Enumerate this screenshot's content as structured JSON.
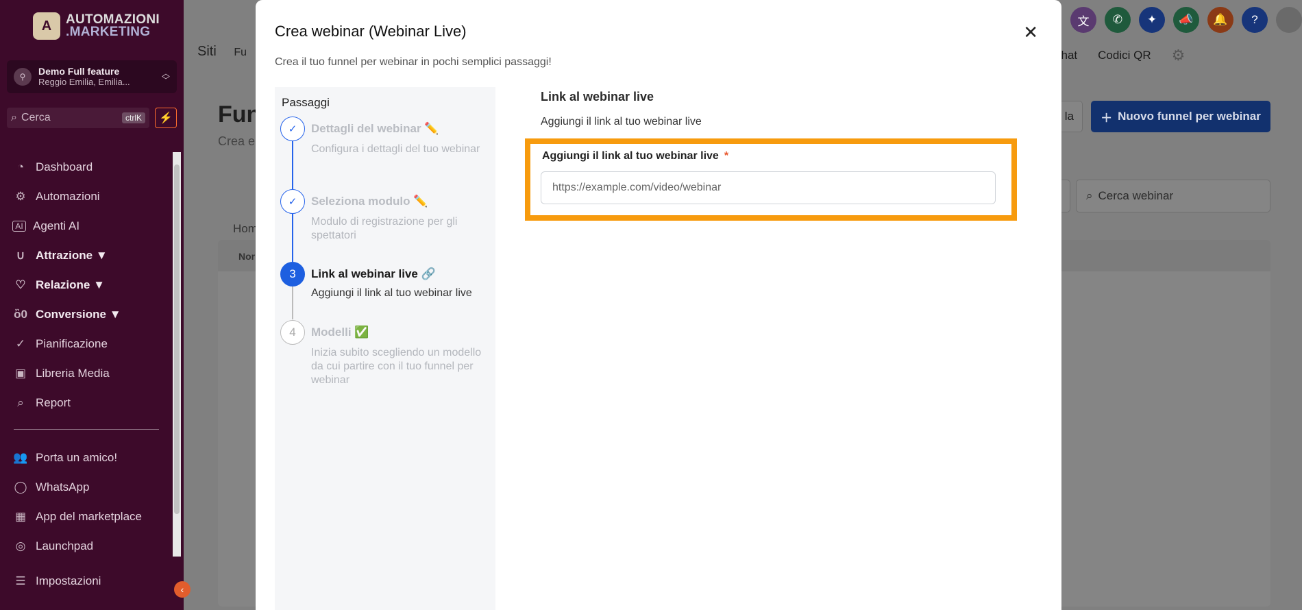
{
  "sidebar": {
    "logo_line1": "AUTOMAZIONI",
    "logo_line2": ".MARKETING",
    "account_name": "Demo Full feature",
    "account_location": "Reggio Emilia, Emilia...",
    "search_placeholder": "Cerca",
    "search_shortcut": "ctrlK",
    "items": [
      {
        "label": "Dashboard",
        "icon": "dashboard-icon"
      },
      {
        "label": "Automazioni",
        "icon": "gear-icon"
      },
      {
        "label": "Agenti AI",
        "icon": "ai-icon"
      },
      {
        "label": "Attrazione ▼",
        "icon": "magnet-icon"
      },
      {
        "label": "Relazione ▼",
        "icon": "heart-icon"
      },
      {
        "label": "Conversione ▼",
        "icon": "money-bag-icon"
      },
      {
        "label": "Pianificazione",
        "icon": "check-circle-icon"
      },
      {
        "label": "Libreria Media",
        "icon": "image-icon"
      },
      {
        "label": "Report",
        "icon": "report-icon"
      }
    ],
    "items2": [
      {
        "label": "Porta un amico!",
        "icon": "users-icon"
      },
      {
        "label": "WhatsApp",
        "icon": "whatsapp-icon"
      },
      {
        "label": "App del marketplace",
        "icon": "grid-icon"
      },
      {
        "label": "Launchpad",
        "icon": "rocket-icon"
      }
    ],
    "settings_label": "Impostazioni"
  },
  "background": {
    "tab_sites": "Siti",
    "tab_partial": "Fu",
    "right_tab_chat": "chat",
    "right_tab_qr": "Codici QR",
    "title": "Fun",
    "subtitle": "Crea e",
    "secondary_button": "la",
    "primary_button": "Nuovo funnel per webinar",
    "search_placeholder": "Cerca webinar",
    "breadcrumb": "Hom",
    "table_header": "Nor"
  },
  "modal": {
    "title": "Crea webinar (Webinar Live)",
    "subtitle": "Crea il tuo funnel per webinar in pochi semplici passaggi!",
    "steps_heading": "Passaggi",
    "steps": [
      {
        "number": "✓",
        "title": "Dettagli del webinar",
        "emoji": "✏️",
        "desc": "Configura i dettagli del tuo webinar",
        "state": "done"
      },
      {
        "number": "✓",
        "title": "Seleziona modulo",
        "emoji": "✏️",
        "desc": "Modulo di registrazione per gli spettatori",
        "state": "done"
      },
      {
        "number": "3",
        "title": "Link al webinar live",
        "emoji": "🔗",
        "desc": "Aggiungi il link al tuo webinar live",
        "state": "active"
      },
      {
        "number": "4",
        "title": "Modelli",
        "emoji": "✅",
        "desc": "Inizia subito scegliendo un modello da cui partire con il tuo funnel per webinar",
        "state": "todo"
      }
    ],
    "section_title": "Link al webinar live",
    "section_desc": "Aggiungi il link al tuo webinar live",
    "field_label": "Aggiungi il link al tuo webinar live",
    "field_required": "*",
    "field_value": "",
    "field_placeholder": "https://example.com/video/webinar"
  },
  "colors": {
    "sidebar_bg": "#3d0a2a",
    "accent_blue": "#1d5fe0",
    "highlight": "#f79b0e"
  }
}
